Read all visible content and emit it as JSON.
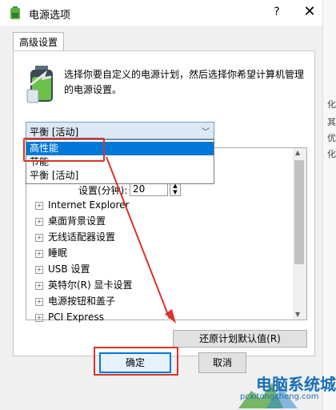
{
  "window": {
    "title": "电源选项",
    "help": "?",
    "close": "✕"
  },
  "tab": {
    "label": "高级设置"
  },
  "description": "选择你要自定义的电源计划，然后选择你希望计算机管理的电源设置。",
  "plan_select": {
    "value": "平衡 [活动]",
    "options": [
      "高性能",
      "节能",
      "平衡 [活动]"
    ],
    "highlighted_index": 0
  },
  "setting": {
    "label": "设置(分钟):",
    "value": "20"
  },
  "tree_items": [
    "Internet Explorer",
    "桌面背景设置",
    "无线适配器设置",
    "睡眠",
    "USB 设置",
    "英特尔(R) 显卡设置",
    "电源按钮和盖子",
    "PCI Express"
  ],
  "buttons": {
    "restore": "还原计划默认值(R)",
    "ok": "确定",
    "cancel": "取消"
  },
  "watermark": {
    "title": "电脑系统城",
    "url": "pcxitongcheng.com"
  },
  "right_strip_chars": [
    "化",
    "其",
    "优",
    "化"
  ],
  "colors": {
    "accent": "#0078d7",
    "annotation": "#d9342b",
    "watermark": "#1a6fb5"
  }
}
